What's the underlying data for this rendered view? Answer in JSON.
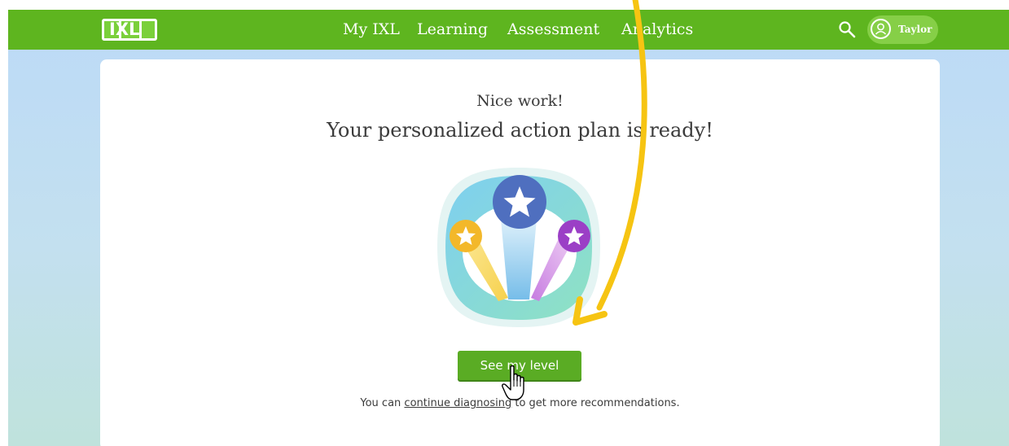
{
  "brand": {
    "logo_text": "IXL",
    "primary_color": "#5eb51f",
    "accent_arrow_color": "#f6c412"
  },
  "nav": {
    "items": [
      {
        "label": "My IXL"
      },
      {
        "label": "Learning"
      },
      {
        "label": "Assessment"
      },
      {
        "label": "Analytics"
      }
    ],
    "search_icon": "search-icon",
    "user": {
      "name": "Taylor",
      "icon": "user-icon"
    }
  },
  "main": {
    "heading": "Nice work!",
    "subheading": "Your personalized action plan is ready!",
    "illustration": "action-plan-stars-illustration",
    "cta_label": "See my level",
    "footnote": {
      "prefix": "You can ",
      "link": "continue diagnosing",
      "suffix": " to get more recommendations."
    }
  }
}
